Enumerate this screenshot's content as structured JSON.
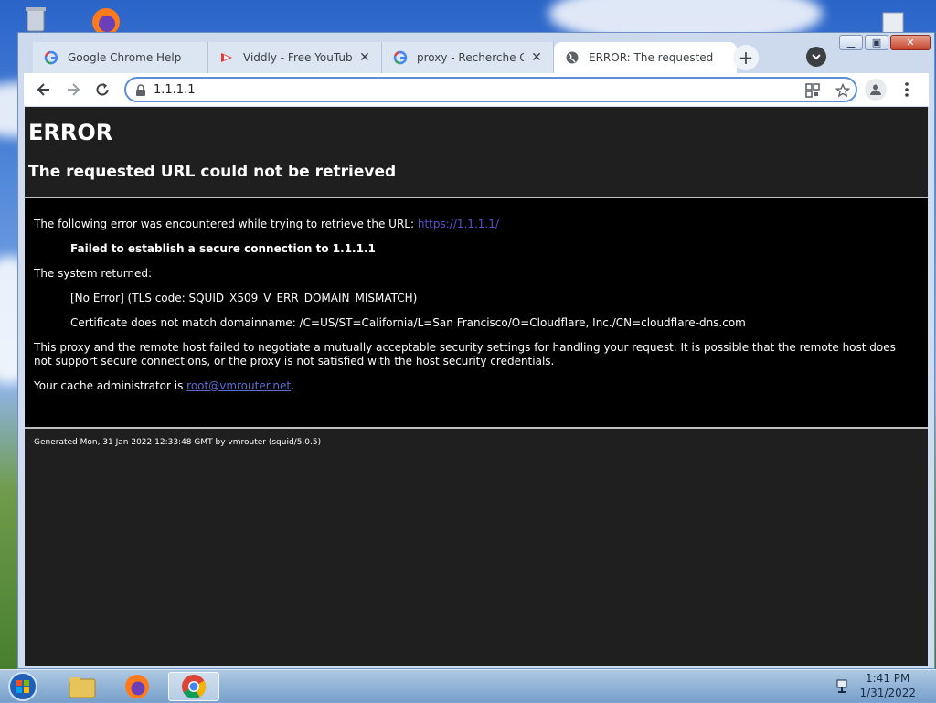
{
  "colors": {
    "page_bg": "#1f1f1f",
    "error_band": "#000000",
    "link": "#5a6fd6",
    "omnibox_focus": "#5b8ed6"
  },
  "tabs": [
    {
      "title": "Google Chrome Help",
      "icon": "google-g-icon",
      "active": false
    },
    {
      "title": "Viddly - Free YouTube D",
      "icon": "viddly-icon",
      "active": false
    },
    {
      "title": "proxy - Recherche Goo",
      "icon": "google-g-icon",
      "active": false
    },
    {
      "title": "ERROR: The requested",
      "icon": "globe-icon",
      "active": true
    }
  ],
  "address_bar": {
    "value": "1.1.1.1"
  },
  "page": {
    "heading": "ERROR",
    "subheading": "The requested URL could not be retrieved",
    "intro": "The following error was encountered while trying to retrieve the URL: ",
    "url_link": "https://1.1.1.1/",
    "failure": "Failed to establish a secure connection to 1.1.1.1",
    "system_returned": "The system returned:",
    "tls_error": "[No Error] (TLS code: SQUID_X509_V_ERR_DOMAIN_MISMATCH)",
    "cert_error": "Certificate does not match domainname: /C=US/ST=California/L=San Francisco/O=Cloudflare, Inc./CN=cloudflare-dns.com",
    "explanation": "This proxy and the remote host failed to negotiate a mutually acceptable security settings for handling your request. It is possible that the remote host does not support secure connections, or the proxy is not satisfied with the host security credentials.",
    "admin_prefix": "Your cache administrator is ",
    "admin_email": "root@vmrouter.net",
    "admin_suffix": ".",
    "footer": "Generated Mon, 31 Jan 2022 12:33:48 GMT by vmrouter (squid/5.0.5)"
  },
  "taskbar": {
    "items": [
      "start-orb-icon",
      "file-explorer-icon",
      "firefox-icon",
      "chrome-icon"
    ],
    "clock_time": "1:41 PM",
    "clock_date": "1/31/2022"
  }
}
